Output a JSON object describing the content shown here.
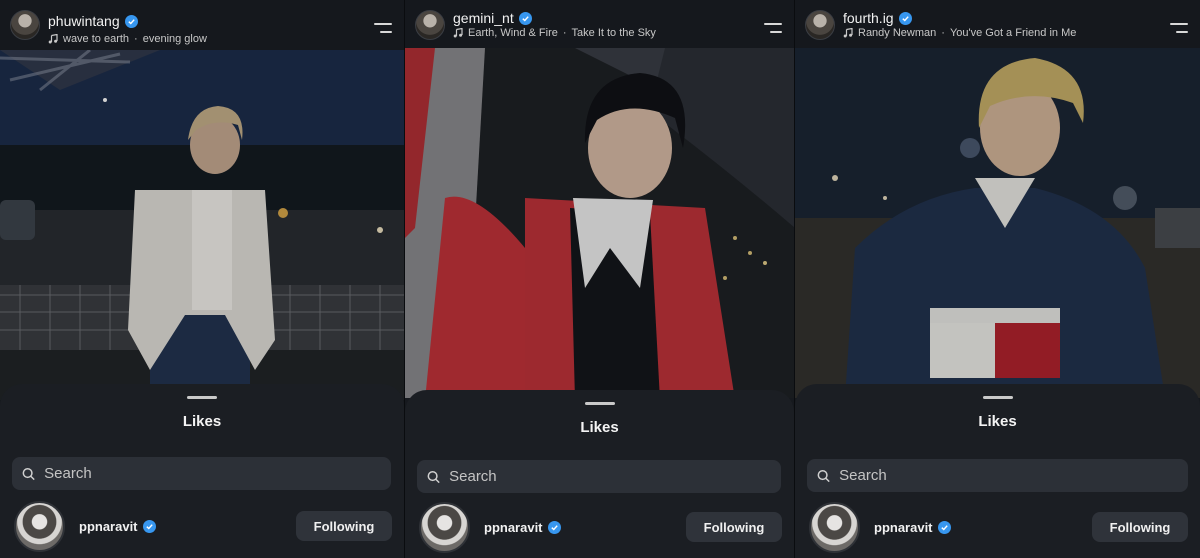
{
  "panels": [
    {
      "username": "phuwintang",
      "song_artist": "wave to earth",
      "song_title": "evening glow",
      "likes_title": "Likes",
      "search_placeholder": "Search",
      "liker": {
        "username": "ppnaravit",
        "button": "Following"
      }
    },
    {
      "username": "gemini_nt",
      "song_artist": "Earth, Wind & Fire",
      "song_title": "Take It to the Sky",
      "likes_title": "Likes",
      "search_placeholder": "Search",
      "liker": {
        "username": "ppnaravit",
        "button": "Following"
      }
    },
    {
      "username": "fourth.ig",
      "song_artist": "Randy Newman",
      "song_title": "You've Got a Friend in Me",
      "likes_title": "Likes",
      "search_placeholder": "Search",
      "liker": {
        "username": "ppnaravit",
        "button": "Following"
      }
    }
  ],
  "separator": " · ",
  "icons": {
    "verified": "verified-badge-icon",
    "music": "music-note-icon",
    "menu": "menu-icon",
    "search": "search-icon"
  },
  "colors": {
    "verified_blue": "#3797f0",
    "sheet_bg": "#1b1e23",
    "button_bg": "#2f333a"
  }
}
